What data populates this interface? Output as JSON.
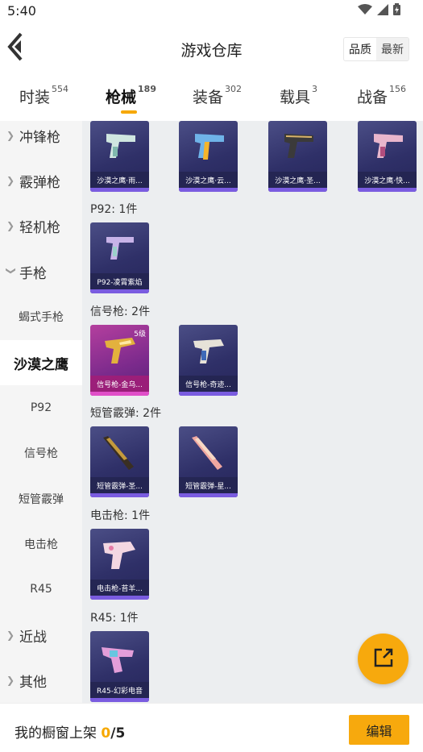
{
  "status_bar": {
    "time": "5:40"
  },
  "header": {
    "title": "游戏仓库",
    "sort_options": [
      "品质",
      "最新"
    ]
  },
  "tabs": [
    {
      "label": "时装",
      "count": "554"
    },
    {
      "label": "枪械",
      "count": "189"
    },
    {
      "label": "装备",
      "count": "302"
    },
    {
      "label": "载具",
      "count": "3"
    },
    {
      "label": "战备",
      "count": "156"
    }
  ],
  "sidebar": {
    "groups": [
      {
        "label": "冲锋枪"
      },
      {
        "label": "霰弹枪"
      },
      {
        "label": "轻机枪"
      },
      {
        "label": "手枪"
      }
    ],
    "subs": [
      "蝎式手枪",
      "沙漠之鹰",
      "P92",
      "信号枪",
      "短管霰弹",
      "电击枪",
      "R45"
    ],
    "tail_groups": [
      {
        "label": "近战"
      },
      {
        "label": "其他"
      }
    ]
  },
  "content": {
    "desert_eagle_items": [
      "沙漠之鹰·雨...",
      "沙漠之鹰·云...",
      "沙漠之鹰·圣...",
      "沙漠之鹰·快..."
    ],
    "p92": {
      "label": "P92: 1件",
      "items": [
        "P92-凌霄紫焰"
      ]
    },
    "flare": {
      "label": "信号枪: 2件",
      "items": [
        "信号枪-金乌...",
        "信号枪-奇迹..."
      ],
      "level": "5级"
    },
    "sawedoff": {
      "label": "短管霰弹: 2件",
      "items": [
        "短管霰弹-圣...",
        "短管霰弹-星..."
      ]
    },
    "stun": {
      "label": "电击枪: 1件",
      "items": [
        "电击枪-苔羊..."
      ]
    },
    "r45": {
      "label": "R45: 1件",
      "items": [
        "R45-幻彩电音"
      ]
    }
  },
  "bottom_bar": {
    "showcase_label": "我的橱窗上架",
    "used": "0",
    "total": "/5",
    "edit_label": "编辑"
  },
  "colors": {
    "accent": "#f6a800",
    "fab": "#f7a90d",
    "card_purple": "#2f3068",
    "card_gold": "#b43f9e"
  },
  "icons": {
    "back": "chevron-left-icon",
    "share": "share-icon",
    "wifi": "wifi-icon",
    "signal": "signal-icon",
    "battery": "battery-icon"
  }
}
